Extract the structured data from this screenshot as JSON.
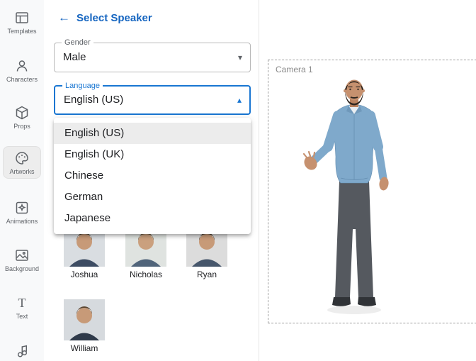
{
  "colors": {
    "accent": "#1565c0",
    "focus_border": "#1976d2"
  },
  "icons": {
    "back": "←",
    "caret_down": "▾",
    "caret_up": "▴"
  },
  "sidebar": {
    "items": [
      {
        "label": "Templates"
      },
      {
        "label": "Characters"
      },
      {
        "label": "Props"
      },
      {
        "label": "Artworks",
        "active": true
      },
      {
        "label": "Animations"
      },
      {
        "label": "Background"
      },
      {
        "label": "Text"
      },
      {
        "label": ""
      }
    ]
  },
  "panel": {
    "title": "Select Speaker",
    "gender": {
      "label": "Gender",
      "value": "Male"
    },
    "language": {
      "label": "Language",
      "value": "English (US)"
    },
    "language_options": [
      {
        "label": "English (US)",
        "selected": true
      },
      {
        "label": "English (UK)",
        "selected": false
      },
      {
        "label": "Chinese",
        "selected": false
      },
      {
        "label": "German",
        "selected": false
      },
      {
        "label": "Japanese",
        "selected": false
      }
    ],
    "speakers": [
      {
        "name": "Joshua"
      },
      {
        "name": "Nicholas"
      },
      {
        "name": "Ryan"
      },
      {
        "name": "William"
      }
    ]
  },
  "canvas": {
    "camera_label": "Camera 1"
  }
}
